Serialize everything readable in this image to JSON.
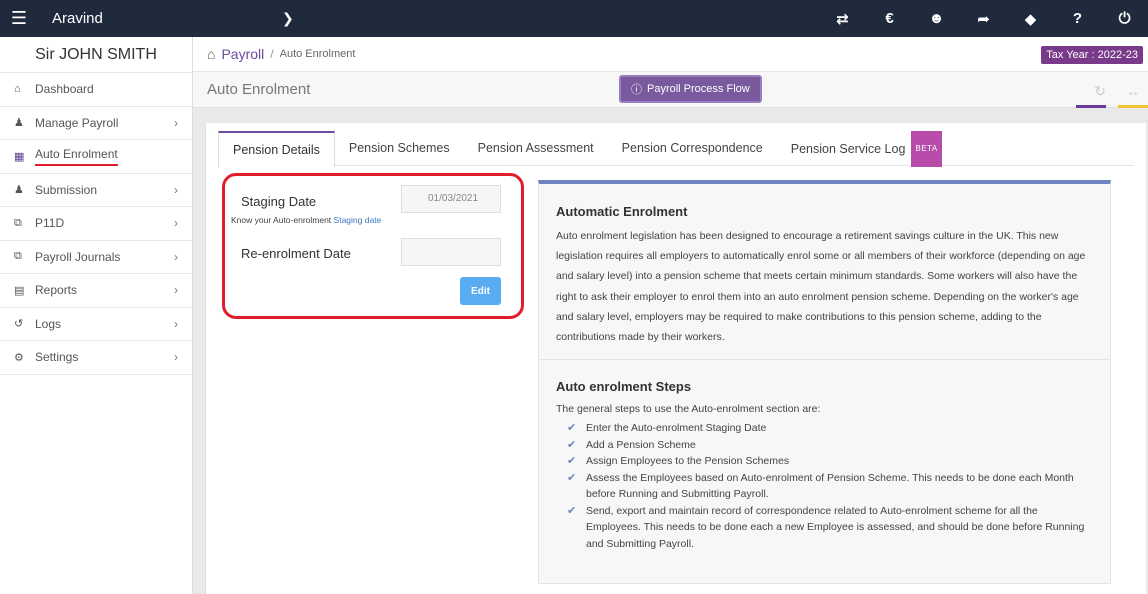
{
  "topbar": {
    "company": "Aravind",
    "icons": [
      "swap-icon",
      "currency-icon",
      "users-icon",
      "megaphone-icon",
      "tag-icon",
      "help-icon",
      "power-icon"
    ]
  },
  "sidebar": {
    "user": "Sir JOHN SMITH",
    "items": [
      {
        "label": "Dashboard",
        "icon": "home-icon",
        "has_arrow": false
      },
      {
        "label": "Manage Payroll",
        "icon": "user-icon",
        "has_arrow": true
      },
      {
        "label": "Auto Enrolment",
        "icon": "grid-icon",
        "has_arrow": false,
        "active": true
      },
      {
        "label": "Submission",
        "icon": "group-icon",
        "has_arrow": true
      },
      {
        "label": "P11D",
        "icon": "copy-icon",
        "has_arrow": true
      },
      {
        "label": "Payroll Journals",
        "icon": "copy-icon",
        "has_arrow": true
      },
      {
        "label": "Reports",
        "icon": "report-icon",
        "has_arrow": true
      },
      {
        "label": "Logs",
        "icon": "history-icon",
        "has_arrow": true
      },
      {
        "label": "Settings",
        "icon": "gear-icon",
        "has_arrow": true
      }
    ]
  },
  "breadcrumb": {
    "root": "Payroll",
    "separator": "/",
    "current": "Auto Enrolment"
  },
  "tax_year": "Tax Year : 2022-23",
  "page_title": "Auto Enrolment",
  "flow_button": "Payroll Process Flow",
  "tabs": [
    {
      "label": "Pension Details",
      "active": true
    },
    {
      "label": "Pension Schemes"
    },
    {
      "label": "Pension Assessment"
    },
    {
      "label": "Pension Correspondence"
    },
    {
      "label": "Pension Service Log",
      "badge": "BETA"
    }
  ],
  "form": {
    "staging_label": "Staging Date",
    "staging_value": "01/03/2021",
    "hint_prefix": "Know your Auto-enrolment",
    "hint_link": "Staging date",
    "reenrol_label": "Re-enrolment Date",
    "reenrol_value": "",
    "edit_label": "Edit"
  },
  "info": {
    "heading1": "Automatic Enrolment",
    "para1": "Auto enrolment legislation has been designed to encourage a retirement savings culture in the UK. This new legislation requires all employers to automatically enrol some or all members of their workforce (depending on age and salary level) into a pension scheme that meets certain minimum standards. Some workers will also have the right to ask their employer to enrol them into an auto enrolment pension scheme. Depending on the worker's age and salary level, employers may be required to make contributions to this pension scheme, adding to the contributions made by their workers.",
    "heading2": "Auto enrolment Steps",
    "intro2": "The general steps to use the Auto-enrolment section are:",
    "steps": [
      "Enter the Auto-enrolment Staging Date",
      "Add a Pension Scheme",
      "Assign Employees to the Pension Schemes",
      "Assess the Employees based on Auto-enrolment of Pension Scheme. This needs to be done each Month before Running and Submitting Payroll.",
      "Send, export and maintain record of correspondence related to Auto-enrolment scheme for all the Employees. This needs to be done each a new Employee is assessed, and should be done before Running and Submitting Payroll."
    ]
  },
  "colors": {
    "topbar": "#1f2a3c",
    "accent_purple": "#6f4a9f",
    "highlight_red": "#e01e2b",
    "edit_blue": "#5aacf2",
    "info_border": "#6d84c2"
  }
}
